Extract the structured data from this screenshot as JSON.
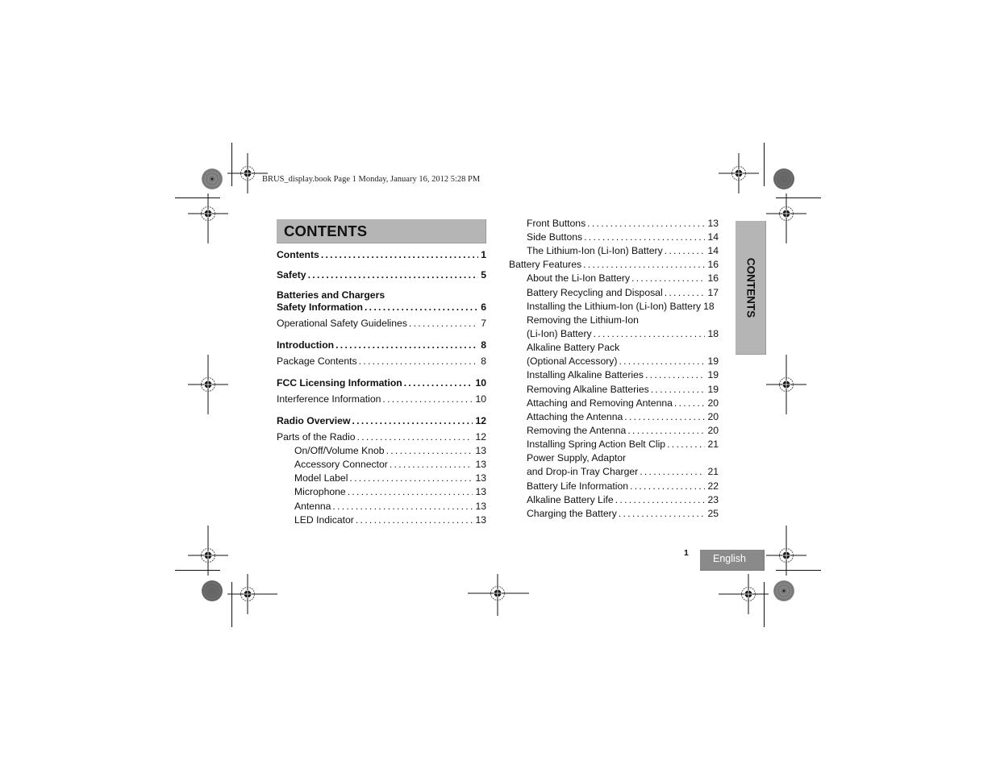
{
  "header": {
    "print_info": "BRUS_display.book  Page 1  Monday, January 16, 2012  5:28 PM"
  },
  "title": "CONTENTS",
  "side_tab": "CONTENTS",
  "footer": {
    "page_number": "1",
    "language_tab": "English"
  },
  "toc_left": [
    {
      "label": "Contents",
      "page": "1",
      "bold": true
    },
    {
      "label": "Safety",
      "page": "5",
      "bold": true
    },
    {
      "line1": "Batteries and Chargers",
      "label": "Safety Information",
      "page": "6",
      "bold": true
    },
    {
      "label": "Operational Safety Guidelines",
      "page": "7",
      "bold": false
    },
    {
      "label": "Introduction",
      "page": "8",
      "bold": true
    },
    {
      "label": "Package Contents",
      "page": "8",
      "bold": false
    },
    {
      "label": "FCC Licensing Information",
      "page": "10",
      "bold": true
    },
    {
      "label": "Interference Information",
      "page": "10",
      "bold": false
    },
    {
      "label": "Radio Overview",
      "page": "12",
      "bold": true
    },
    {
      "label": "Parts of the Radio",
      "page": "12",
      "bold": false
    },
    {
      "label": "On/Off/Volume Knob",
      "page": "13",
      "bold": false
    },
    {
      "label": "Accessory Connector",
      "page": "13",
      "bold": false
    },
    {
      "label": "Model Label",
      "page": "13",
      "bold": false
    },
    {
      "label": "Microphone",
      "page": "13",
      "bold": false
    },
    {
      "label": "Antenna",
      "page": "13",
      "bold": false
    },
    {
      "label": "LED Indicator",
      "page": "13",
      "bold": false
    }
  ],
  "toc_right": [
    {
      "label": "Front Buttons",
      "page": "13"
    },
    {
      "label": "Side Buttons",
      "page": "14"
    },
    {
      "label": "The Lithium-Ion (Li-Ion) Battery",
      "page": "14"
    },
    {
      "label": "Battery Features",
      "page": "16"
    },
    {
      "label": "About the Li-Ion Battery",
      "page": "16"
    },
    {
      "label": "Battery Recycling and Disposal",
      "page": "17"
    },
    {
      "label": "Installing the Lithium-Ion (Li-Ion) Battery",
      "page": "18"
    },
    {
      "line1": "Removing the Lithium-Ion",
      "label": "(Li-Ion) Battery",
      "page": "18"
    },
    {
      "line1": "Alkaline Battery Pack",
      "label": "(Optional Accessory)",
      "page": "19"
    },
    {
      "label": "Installing Alkaline Batteries",
      "page": "19"
    },
    {
      "label": "Removing Alkaline Batteries",
      "page": "19"
    },
    {
      "label": "Attaching and Removing Antenna",
      "page": "20"
    },
    {
      "label": "Attaching the Antenna",
      "page": "20"
    },
    {
      "label": "Removing the Antenna",
      "page": "20"
    },
    {
      "label": "Installing Spring Action Belt Clip",
      "page": "21"
    },
    {
      "line1": "Power Supply, Adaptor",
      "label": "and Drop-in Tray Charger",
      "page": "21"
    },
    {
      "label": "Battery Life Information",
      "page": "22"
    },
    {
      "label": "Alkaline Battery Life",
      "page": "23"
    },
    {
      "label": "Charging the Battery",
      "page": "25"
    }
  ]
}
